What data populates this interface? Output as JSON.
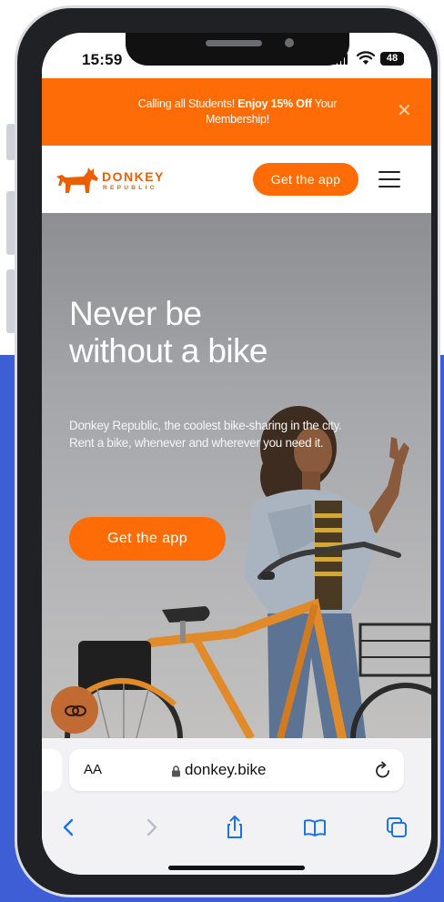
{
  "status_bar": {
    "time": "15:59",
    "battery": "48"
  },
  "promo_banner": {
    "prefix": "Calling all Students! ",
    "highlight": "Enjoy 15% Off",
    "suffix": " Your Membership!",
    "close_icon": "close-icon"
  },
  "navbar": {
    "brand_word": "DONKEY",
    "brand_sub": "REPUBLIC",
    "cta_label": "Get the app",
    "menu_icon": "hamburger-menu-icon"
  },
  "hero": {
    "title_line1": "Never be",
    "title_line2": "without a bike",
    "subtitle_line1": "Donkey Republic, the coolest bike-sharing in the city.",
    "subtitle_line2": "Rent a bike, whenever and wherever you need it.",
    "cta_label": "Get the app"
  },
  "chat_widget": {
    "icon": "chat-bubble-icon"
  },
  "browser": {
    "text_size_label": "AA",
    "url": "donkey.bike",
    "icons": [
      "back-icon",
      "forward-icon",
      "share-icon",
      "bookmarks-icon",
      "tabs-icon",
      "reload-icon",
      "lock-icon"
    ]
  },
  "colors": {
    "accent": "#fd6c06",
    "backdrop_blue": "#3d5ed4",
    "safari_tint": "#1a73e8"
  }
}
